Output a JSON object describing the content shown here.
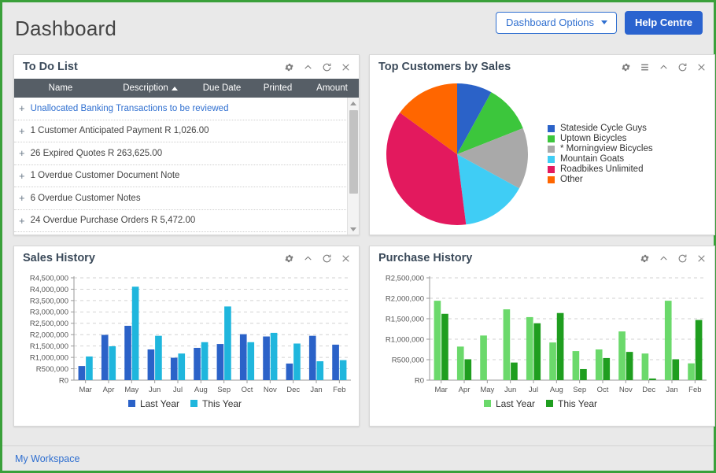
{
  "header": {
    "title": "Dashboard",
    "options_button": "Dashboard Options",
    "help_button": "Help Centre"
  },
  "footer": {
    "workspace_link": "My Workspace"
  },
  "colors": {
    "accent_blue": "#2a63cf",
    "panel_header_text": "#3b4a5a",
    "table_header_bg": "#565e66",
    "frame_green": "#3aa03a",
    "link_blue": "#2f6fd0"
  },
  "panels": {
    "todo": {
      "title": "To Do List",
      "icons": [
        "gear-icon",
        "collapse-icon",
        "refresh-icon",
        "close-icon"
      ],
      "columns": [
        "Name",
        "Description",
        "Due Date",
        "Printed",
        "Amount"
      ],
      "sorted_column": "Description",
      "sort_direction": "ascending",
      "rows": [
        {
          "text": "Unallocated Banking Transactions to be reviewed",
          "is_link": true
        },
        {
          "text": "1 Customer Anticipated Payment R 1,026.00",
          "is_link": false
        },
        {
          "text": "26 Expired Quotes R 263,625.00",
          "is_link": false
        },
        {
          "text": "1 Overdue Customer Document Note",
          "is_link": false
        },
        {
          "text": "6 Overdue Customer Notes",
          "is_link": false
        },
        {
          "text": "24 Overdue Purchase Orders R 5,472.00",
          "is_link": false
        }
      ]
    },
    "customers": {
      "title": "Top Customers by Sales",
      "icons": [
        "gear-icon",
        "list-icon",
        "collapse-icon",
        "refresh-icon",
        "close-icon"
      ]
    },
    "sales": {
      "title": "Sales History",
      "icons": [
        "gear-icon",
        "collapse-icon",
        "refresh-icon",
        "close-icon"
      ]
    },
    "purchase": {
      "title": "Purchase History",
      "icons": [
        "gear-icon",
        "collapse-icon",
        "refresh-icon",
        "close-icon"
      ]
    }
  },
  "chart_data": [
    {
      "id": "top_customers_by_sales",
      "type": "pie",
      "title": "Top Customers by Sales",
      "legend_position": "right",
      "start_angle_deg": 0,
      "labels": [
        "Stateside Cycle Guys",
        "Uptown Bicycles",
        "* Morningview Bicycles",
        "Mountain Goats",
        "Roadbikes Unlimited",
        "Other"
      ],
      "values": [
        8,
        11,
        14,
        15,
        37,
        15
      ],
      "colors": [
        "#2b62c8",
        "#3cc63c",
        "#a9a9a9",
        "#3fcdf5",
        "#e3195e",
        "#ff6600"
      ]
    },
    {
      "id": "sales_history",
      "type": "bar",
      "title": "Sales History",
      "xlabel": "",
      "ylabel": "",
      "ylim": [
        0,
        4500000
      ],
      "grid": true,
      "currency_prefix": "R",
      "ytick_labels": [
        "R0",
        "R500,000",
        "R1,000,000",
        "R1,500,000",
        "R2,000,000",
        "R2,500,000",
        "R3,000,000",
        "R3,500,000",
        "R4,000,000",
        "R4,500,000"
      ],
      "yticks": [
        0,
        500000,
        1000000,
        1500000,
        2000000,
        2500000,
        3000000,
        3500000,
        4000000,
        4500000
      ],
      "categories": [
        "Mar",
        "Apr",
        "May",
        "Jun",
        "Jul",
        "Aug",
        "Sep",
        "Oct",
        "Nov",
        "Dec",
        "Jan",
        "Feb"
      ],
      "series": [
        {
          "name": "Last Year",
          "color": "#2b62c8",
          "values": [
            620000,
            1990000,
            2390000,
            1350000,
            985000,
            1420000,
            1590000,
            2020000,
            1920000,
            730000,
            1950000,
            1560000
          ]
        },
        {
          "name": "This Year",
          "color": "#1fb6dd",
          "values": [
            1040000,
            1490000,
            4110000,
            1950000,
            1170000,
            1670000,
            3240000,
            1670000,
            2080000,
            1610000,
            830000,
            880000
          ]
        }
      ]
    },
    {
      "id": "purchase_history",
      "type": "bar",
      "title": "Purchase History",
      "xlabel": "",
      "ylabel": "",
      "ylim": [
        0,
        2500000
      ],
      "grid": true,
      "currency_prefix": "R",
      "ytick_labels": [
        "R0",
        "R500,000",
        "R1,000,000",
        "R1,500,000",
        "R2,000,000",
        "R2,500,000"
      ],
      "yticks": [
        0,
        500000,
        1000000,
        1500000,
        2000000,
        2500000
      ],
      "categories": [
        "Mar",
        "Apr",
        "May",
        "Jun",
        "Jul",
        "Aug",
        "Sep",
        "Oct",
        "Nov",
        "Dec",
        "Jan",
        "Feb"
      ],
      "series": [
        {
          "name": "Last Year",
          "color": "#6bd96b",
          "values": [
            1940000,
            820000,
            1090000,
            1730000,
            1540000,
            920000,
            710000,
            750000,
            1190000,
            650000,
            1940000,
            410000
          ]
        },
        {
          "name": "This Year",
          "color": "#1f9e1f",
          "values": [
            1620000,
            510000,
            0,
            430000,
            1390000,
            1640000,
            270000,
            540000,
            690000,
            40000,
            510000,
            1470000
          ]
        }
      ]
    }
  ]
}
